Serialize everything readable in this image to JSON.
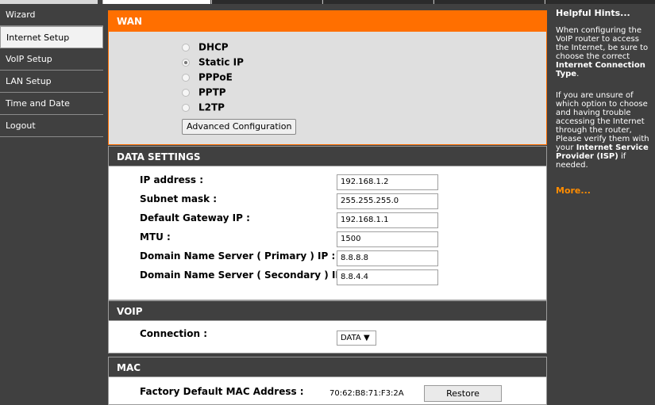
{
  "nav": {
    "items": [
      {
        "label": "Wizard"
      },
      {
        "label": "Internet Setup"
      },
      {
        "label": "VoIP Setup"
      },
      {
        "label": "LAN Setup"
      },
      {
        "label": "Time and Date"
      },
      {
        "label": "Logout"
      }
    ],
    "active_index": 1
  },
  "wan": {
    "title": "WAN",
    "options": [
      {
        "label": "DHCP",
        "checked": false
      },
      {
        "label": "Static IP",
        "checked": true
      },
      {
        "label": "PPPoE",
        "checked": false
      },
      {
        "label": "PPTP",
        "checked": false
      },
      {
        "label": "L2TP",
        "checked": false
      }
    ],
    "advanced_button": "Advanced Configuration"
  },
  "data_settings": {
    "title": "DATA SETTINGS",
    "fields": [
      {
        "label": "IP address :",
        "value": "192.168.1.2"
      },
      {
        "label": "Subnet mask :",
        "value": "255.255.255.0"
      },
      {
        "label": "Default Gateway IP :",
        "value": "192.168.1.1"
      },
      {
        "label": "MTU :",
        "value": "1500"
      },
      {
        "label": "Domain Name Server ( Primary ) IP :",
        "value": "8.8.8.8"
      },
      {
        "label": "Domain Name Server ( Secondary ) IP :",
        "value": "8.8.4.4"
      }
    ]
  },
  "voip": {
    "title": "VOIP",
    "connection_label": "Connection :",
    "connection_value": "DATA ▼"
  },
  "mac": {
    "title": "MAC",
    "label": "Factory Default MAC Address :",
    "value": "70:62:B8:71:F3:2A",
    "restore_button": "Restore"
  },
  "hints": {
    "title": "Helpful Hints...",
    "p1_a": "When configuring the VoIP router to access the Internet, be sure to choose the correct",
    "p1_b": "Internet Connection Type",
    "p1_c": ".",
    "p2_a": "If you are unsure of which option to choose and having trouble accessing the Internet through the router, Please verify them with your",
    "p2_b": "Internet Service Provider (ISP)",
    "p2_c": "if needed.",
    "more": "More..."
  },
  "colors": {
    "accent": "#ff6f00",
    "dark": "#404040",
    "hint_link": "#ff8c00"
  }
}
